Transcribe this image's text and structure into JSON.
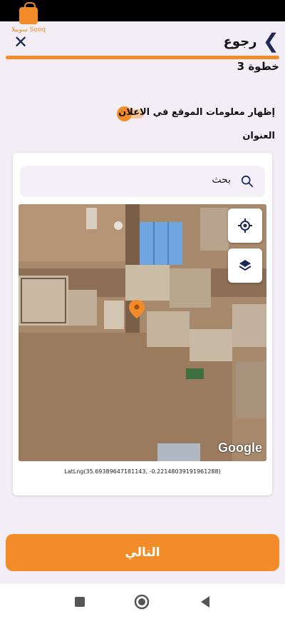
{
  "app": {
    "logo_text": "سوبيلا Sooq",
    "accent_color": "#f28c28",
    "nav_color": "#1f2a57"
  },
  "header": {
    "back_label": "رجوع",
    "close_icon": "close-icon",
    "back_icon": "chevron-right-icon",
    "step_label": "خطوة 3",
    "progress": 1.0
  },
  "form": {
    "show_location_label": "إظهار معلومات الموقع في الاعلان",
    "show_location_enabled": true,
    "address_label": "العنوان"
  },
  "map": {
    "search_placeholder": "بحث",
    "search_icon": "search-icon",
    "my_location_icon": "my-location-icon",
    "layers_icon": "layers-icon",
    "marker_icon": "map-pin-icon",
    "attribution": "Google",
    "coordinates": "LatLng(35.69389647181143, -0.22148039191961288)"
  },
  "footer": {
    "next_label": "التالي"
  },
  "system_nav": {
    "recents_icon": "square-icon",
    "home_icon": "circle-icon",
    "back_icon": "triangle-back-icon"
  }
}
